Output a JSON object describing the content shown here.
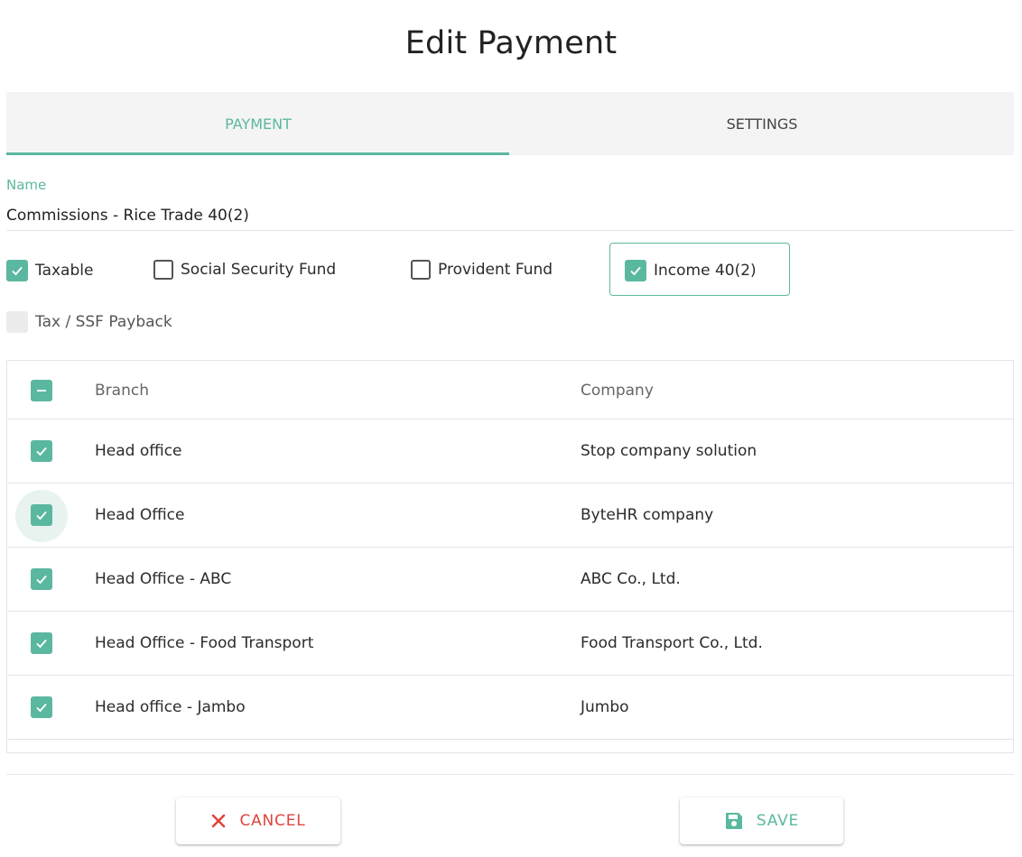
{
  "dialog": {
    "title": "Edit Payment"
  },
  "tabs": [
    {
      "label": "PAYMENT",
      "active": true
    },
    {
      "label": "SETTINGS",
      "active": false
    }
  ],
  "form": {
    "name_label": "Name",
    "name_value": "Commissions - Rice Trade 40(2)"
  },
  "options": {
    "taxable": {
      "label": "Taxable",
      "checked": true
    },
    "social_security_fund": {
      "label": "Social Security Fund",
      "checked": false
    },
    "provident_fund": {
      "label": "Provident Fund",
      "checked": false
    },
    "income_40_2": {
      "label": "Income 40(2)",
      "checked": true
    },
    "tax_ssf_payback": {
      "label": "Tax / SSF Payback",
      "checked": false,
      "disabled": true
    }
  },
  "table": {
    "columns": [
      "Branch",
      "Company"
    ],
    "select_all_state": "indeterminate",
    "rows": [
      {
        "branch": "Head office",
        "company": "Stop company solution",
        "checked": true
      },
      {
        "branch": "Head Office",
        "company": "ByteHR company",
        "checked": true
      },
      {
        "branch": "Head Office - ABC",
        "company": "ABC Co., Ltd.",
        "checked": true
      },
      {
        "branch": "Head Office - Food Transport",
        "company": "Food Transport Co., Ltd.",
        "checked": true
      },
      {
        "branch": "Head office - Jambo",
        "company": "Jumbo",
        "checked": true
      }
    ]
  },
  "actions": {
    "cancel_label": "CANCEL",
    "save_label": "SAVE"
  },
  "colors": {
    "accent": "#5bb8a0",
    "danger": "#e0443c"
  },
  "icons": {
    "check": "check-icon",
    "indeterminate": "minus-icon",
    "cancel": "close-icon",
    "save": "floppy-disk-icon"
  }
}
